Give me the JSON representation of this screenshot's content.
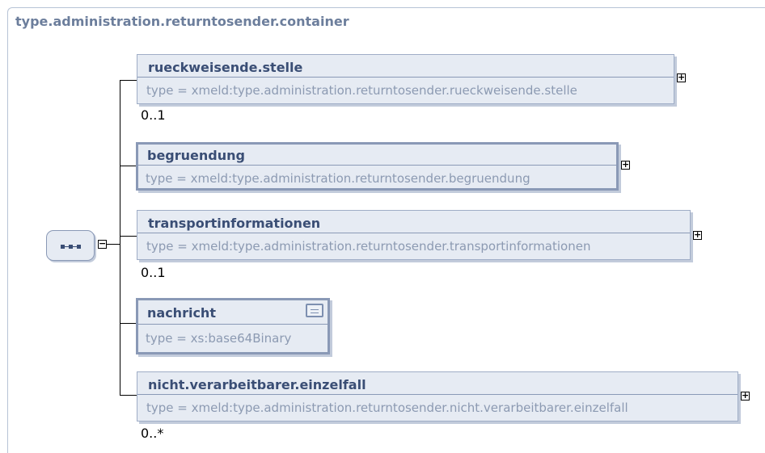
{
  "container": {
    "title": "type.administration.returntosender.container"
  },
  "sequence": {
    "label": "sequence",
    "collapse_symbol": "−"
  },
  "elements": [
    {
      "name": "rueckweisende.stelle",
      "type": "type = xmeld:type.administration.returntosender.rueckweisende.stelle",
      "cardinality": "0..1",
      "expand_symbol": "+"
    },
    {
      "name": "begruendung",
      "type": "type = xmeld:type.administration.returntosender.begruendung",
      "cardinality": "",
      "expand_symbol": "+"
    },
    {
      "name": "transportinformationen",
      "type": "type = xmeld:type.administration.returntosender.transportinformationen",
      "cardinality": "0..1",
      "expand_symbol": "+"
    },
    {
      "name": "nachricht",
      "type": "type = xs:base64Binary",
      "cardinality": "",
      "icon": "documentation-icon"
    },
    {
      "name": "nicht.verarbeitbarer.einzelfall",
      "type": "type = xmeld:type.administration.returntosender.nicht.verarbeitbarer.einzelfall",
      "cardinality": "0..*",
      "expand_symbol": "+"
    }
  ]
}
